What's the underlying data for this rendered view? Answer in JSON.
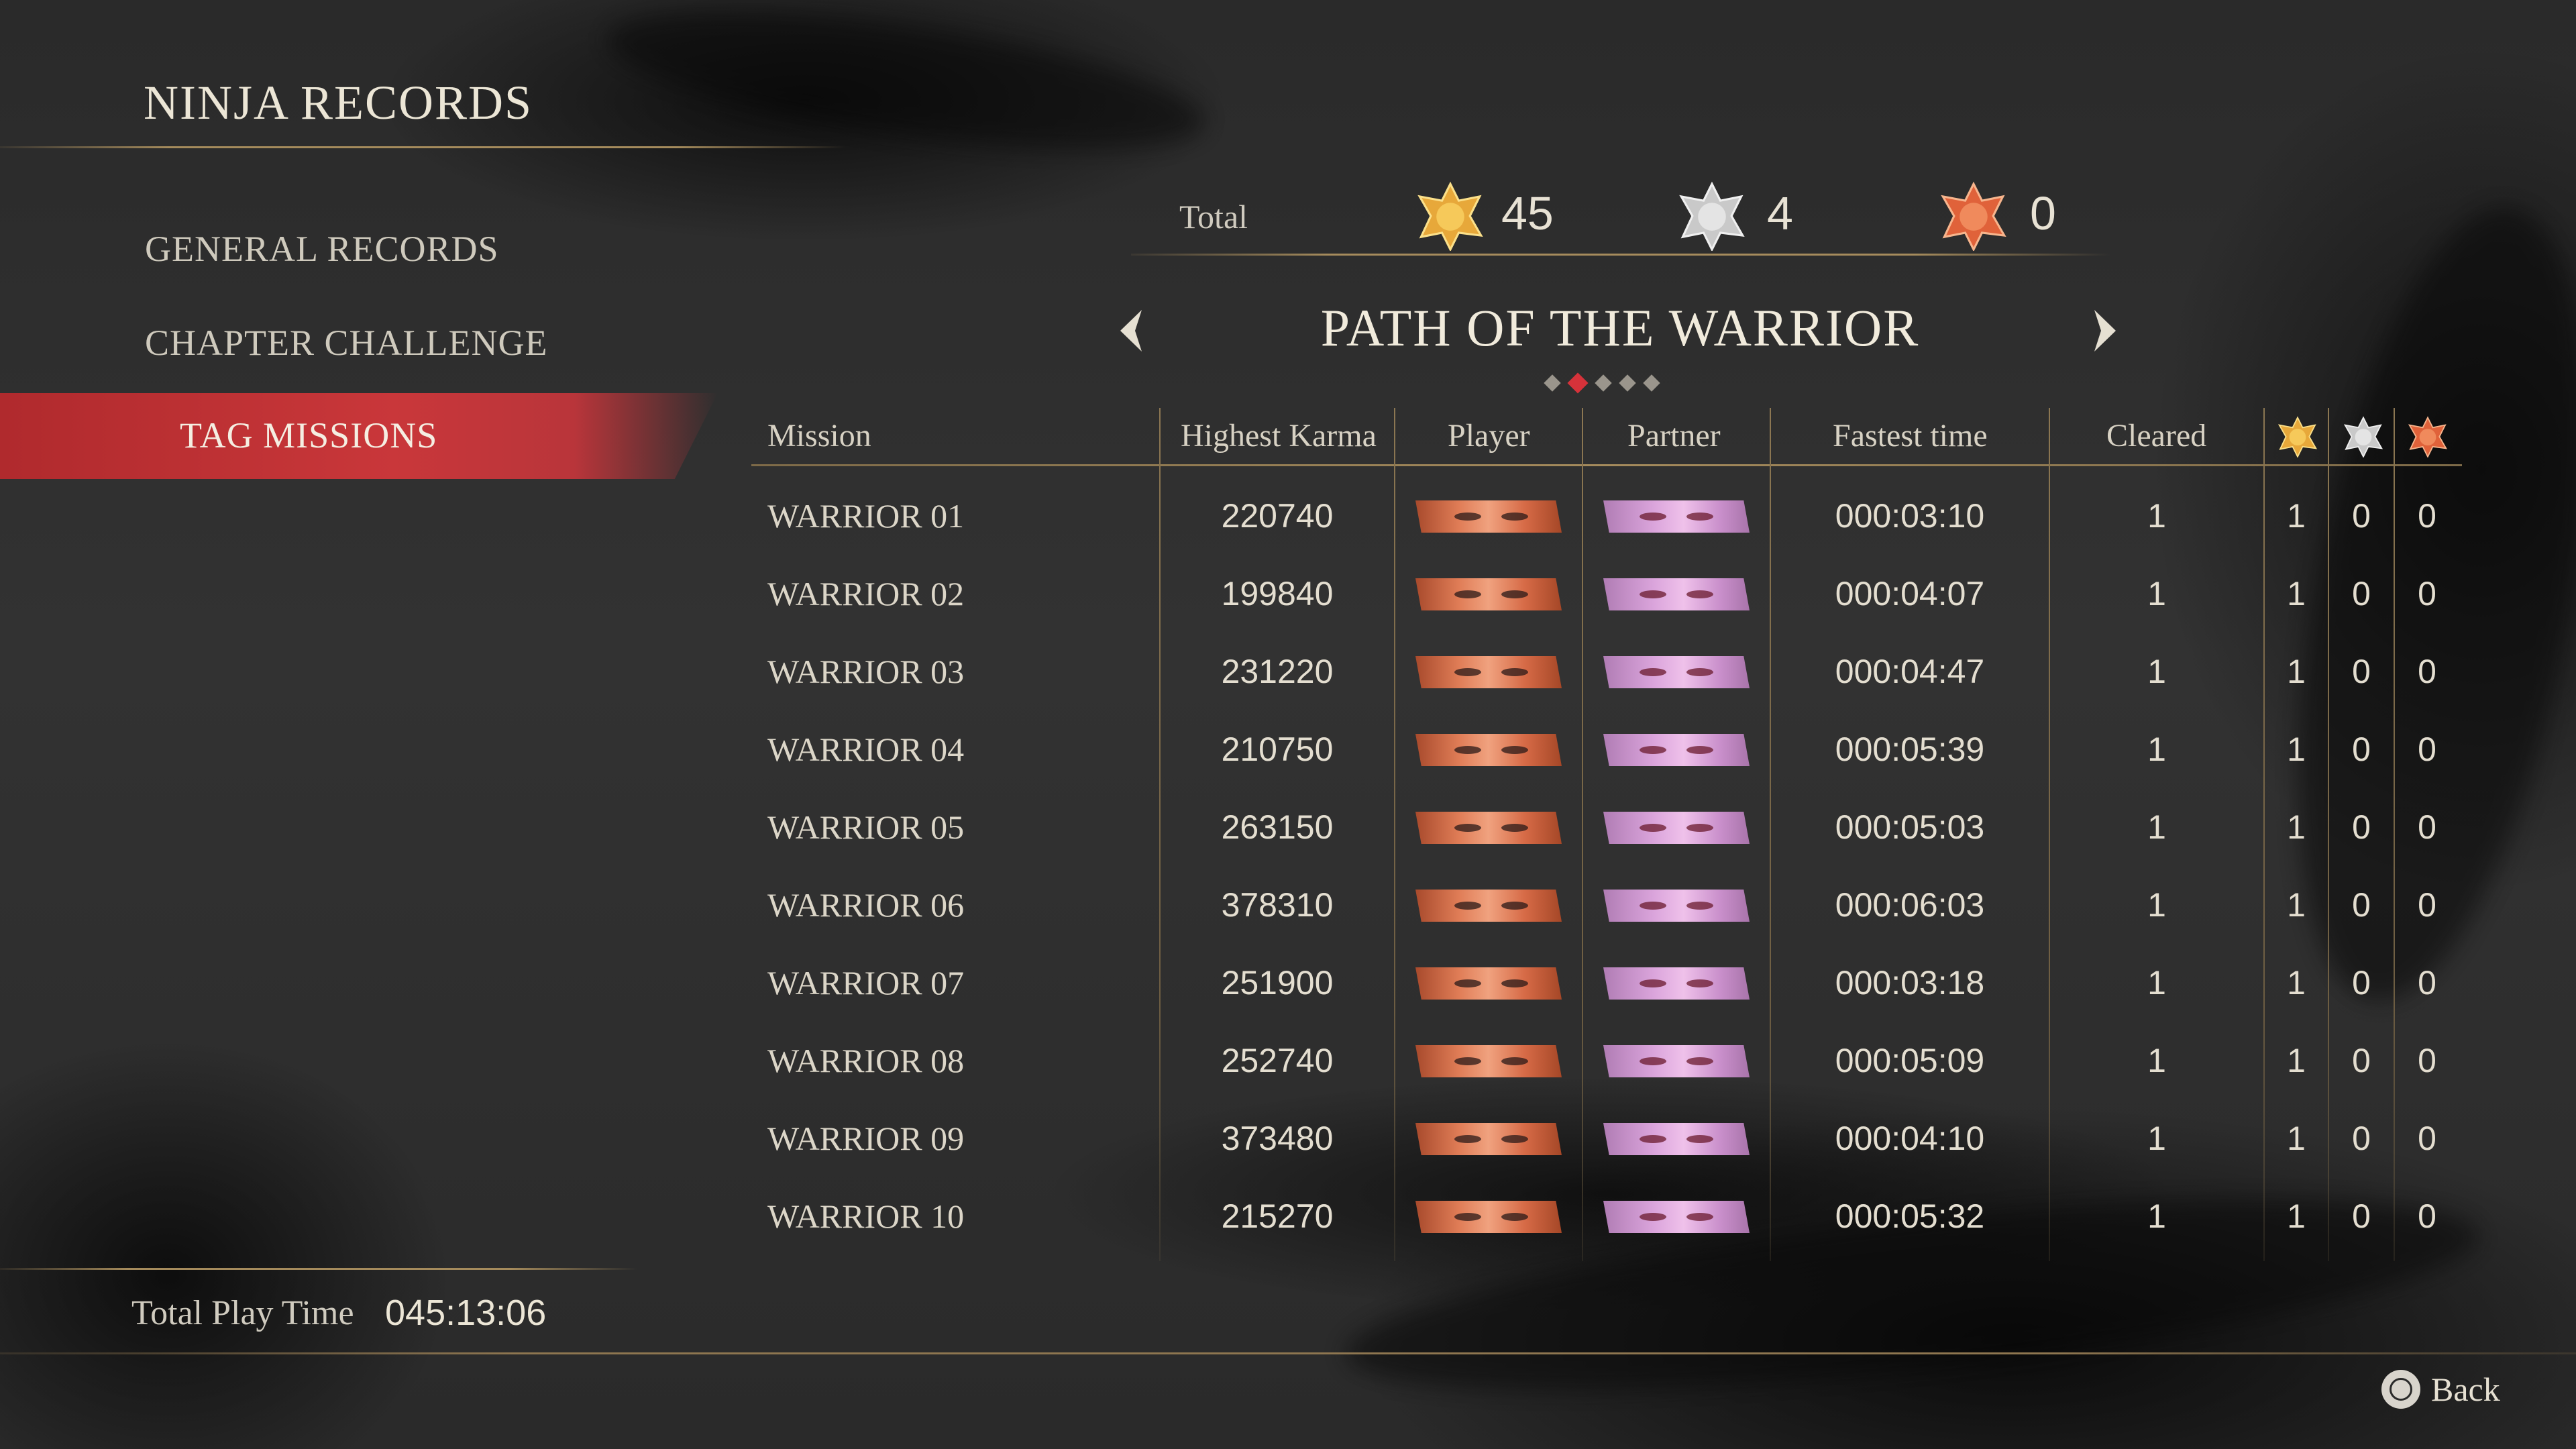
{
  "title": "NINJA RECORDS",
  "menu": {
    "general": "GENERAL RECORDS",
    "chapter": "CHAPTER CHALLENGE",
    "tag": "TAG MISSIONS"
  },
  "totals": {
    "label": "Total",
    "gold": "45",
    "silver": "4",
    "bronze": "0"
  },
  "category": {
    "title": "PATH OF THE WARRIOR",
    "page_index": 2,
    "page_count": 5
  },
  "table": {
    "headers": {
      "mission": "Mission",
      "karma": "Highest Karma",
      "player": "Player",
      "partner": "Partner",
      "time": "Fastest time",
      "cleared": "Cleared"
    },
    "rows": [
      {
        "mission": "WARRIOR 01",
        "karma": "220740",
        "time": "000:03:10",
        "cleared": "1",
        "gold": "1",
        "silver": "0",
        "bronze": "0"
      },
      {
        "mission": "WARRIOR 02",
        "karma": "199840",
        "time": "000:04:07",
        "cleared": "1",
        "gold": "1",
        "silver": "0",
        "bronze": "0"
      },
      {
        "mission": "WARRIOR 03",
        "karma": "231220",
        "time": "000:04:47",
        "cleared": "1",
        "gold": "1",
        "silver": "0",
        "bronze": "0"
      },
      {
        "mission": "WARRIOR 04",
        "karma": "210750",
        "time": "000:05:39",
        "cleared": "1",
        "gold": "1",
        "silver": "0",
        "bronze": "0"
      },
      {
        "mission": "WARRIOR 05",
        "karma": "263150",
        "time": "000:05:03",
        "cleared": "1",
        "gold": "1",
        "silver": "0",
        "bronze": "0"
      },
      {
        "mission": "WARRIOR 06",
        "karma": "378310",
        "time": "000:06:03",
        "cleared": "1",
        "gold": "1",
        "silver": "0",
        "bronze": "0"
      },
      {
        "mission": "WARRIOR 07",
        "karma": "251900",
        "time": "000:03:18",
        "cleared": "1",
        "gold": "1",
        "silver": "0",
        "bronze": "0"
      },
      {
        "mission": "WARRIOR 08",
        "karma": "252740",
        "time": "000:05:09",
        "cleared": "1",
        "gold": "1",
        "silver": "0",
        "bronze": "0"
      },
      {
        "mission": "WARRIOR 09",
        "karma": "373480",
        "time": "000:04:10",
        "cleared": "1",
        "gold": "1",
        "silver": "0",
        "bronze": "0"
      },
      {
        "mission": "WARRIOR 10",
        "karma": "215270",
        "time": "000:05:32",
        "cleared": "1",
        "gold": "1",
        "silver": "0",
        "bronze": "0"
      }
    ]
  },
  "playtime": {
    "label": "Total Play Time",
    "value": "045:13:06"
  },
  "back_label": "Back",
  "colors": {
    "accent_red": "#c9373a",
    "gold_line": "#a58b5c",
    "medal_gold": "#e7a83a",
    "medal_silver": "#c9c9c9",
    "medal_bronze": "#e0623a"
  }
}
